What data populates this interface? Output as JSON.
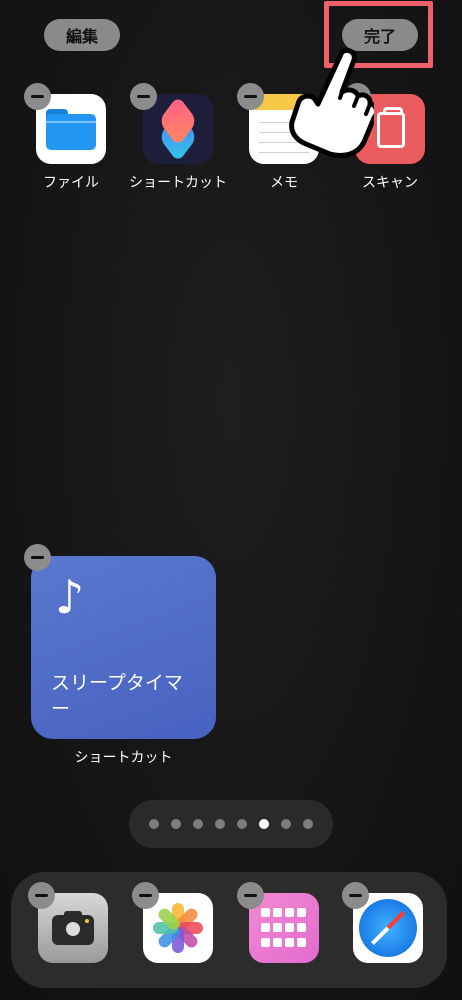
{
  "header": {
    "edit_label": "編集",
    "done_label": "完了"
  },
  "apps_top": [
    {
      "label": "ファイル",
      "icon": "files-icon"
    },
    {
      "label": "ショートカット",
      "icon": "shortcuts-icon"
    },
    {
      "label": "メモ",
      "icon": "notes-icon"
    },
    {
      "label": "スキャン",
      "icon": "scan-icon"
    }
  ],
  "widget": {
    "icon": "music-note-icon",
    "title": "スリープタイマー",
    "label": "ショートカット",
    "color": "#4f6cc8"
  },
  "page_dots": {
    "count": 8,
    "active_index": 5
  },
  "dock": [
    {
      "name": "camera",
      "icon": "camera-icon"
    },
    {
      "name": "photos",
      "icon": "photos-icon"
    },
    {
      "name": "app-library",
      "icon": "app-grid-icon"
    },
    {
      "name": "safari",
      "icon": "safari-icon"
    }
  ],
  "colors": {
    "highlight": "#f0606a",
    "button_bg": "#8a8a8a",
    "background": "#151515"
  }
}
